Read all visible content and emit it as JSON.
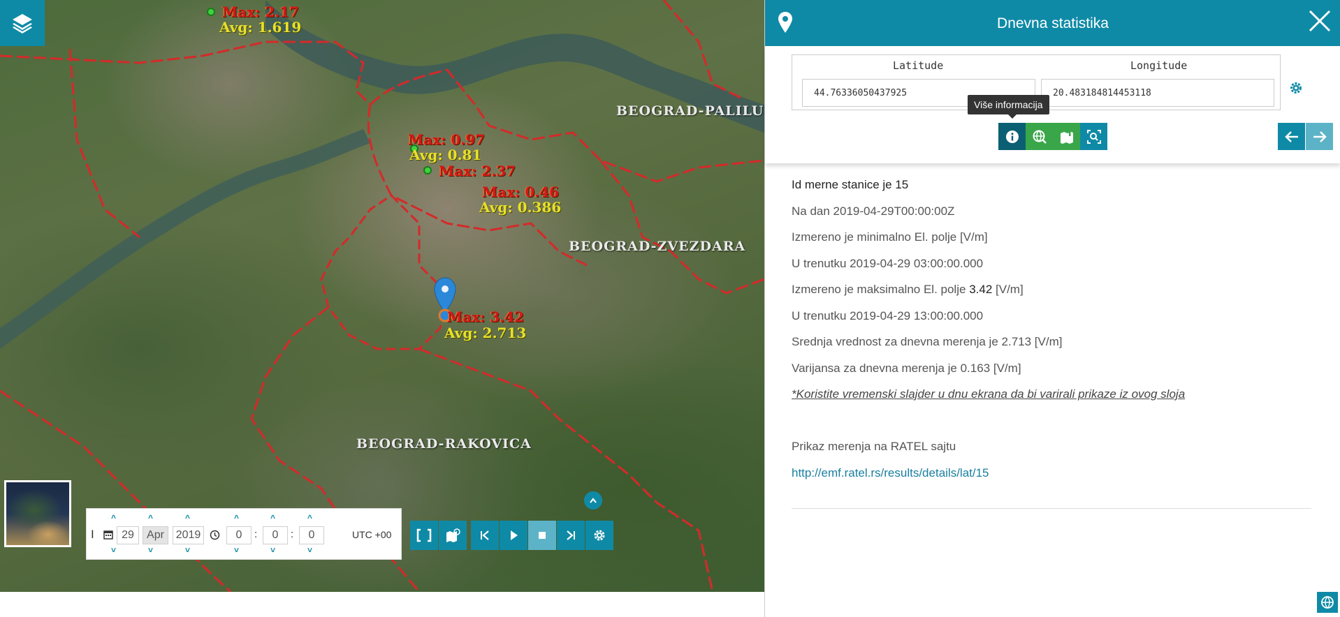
{
  "map": {
    "district_labels": [
      "BEOGRAD-PALILU",
      "BEOGRAD-ZVEZDARA",
      "BEOGRAD-RAKOVICA"
    ],
    "stations": [
      {
        "max": "Max: 2.17",
        "avg": "Avg: 1.619"
      },
      {
        "max": "Max: 0.97",
        "avg": "Avg: 0.81"
      },
      {
        "max": "Max: 2.37",
        "avg": ""
      },
      {
        "max": "Max: 0.46",
        "avg": "Avg: 0.386"
      },
      {
        "max": "Max: 3.42",
        "avg": "Avg: 2.713"
      }
    ],
    "boundary_color": "#d42a2a",
    "accent": "#0f8aa6"
  },
  "timebar": {
    "day": "29",
    "month": "Apr",
    "year": "2019",
    "hour": "0",
    "minute": "0",
    "second": "0",
    "timezone": "UTC +00",
    "icons": [
      "cursor-icon",
      "calendar-icon",
      "clock-icon"
    ]
  },
  "panel": {
    "title": "Dnevna statistika",
    "latitude_label": "Latitude",
    "longitude_label": "Longitude",
    "latitude_value": "44.76336050437925",
    "longitude_value": "20.483184814453118",
    "tooltip": "Više informacija",
    "info": {
      "station_id": "Id merne stanice je 15",
      "date": "Na dan 2019-04-29T00:00:00Z",
      "min_text": "Izmereno je minimalno El. polje [V/m]",
      "min_time": "U trenutku 2019-04-29 03:00:00.000",
      "max_prefix": "Izmereno je maksimalno El. polje",
      "max_value": "3.42",
      "max_unit": "[V/m]",
      "max_time": "U trenutku 2019-04-29 13:00:00.000",
      "mean": "Srednja vrednost za dnevna merenja je 2.713 [V/m]",
      "variance": "Varijansa za dnevna merenja je 0.163 [V/m]",
      "hint": "*Koristite vremenski slajder u dnu ekrana da bi varirali prikaze iz ovog sloja",
      "ratel_label": "Prikaz merenja na RATEL sajtu",
      "ratel_link": "http://emf.ratel.rs/results/details/lat/15"
    }
  }
}
